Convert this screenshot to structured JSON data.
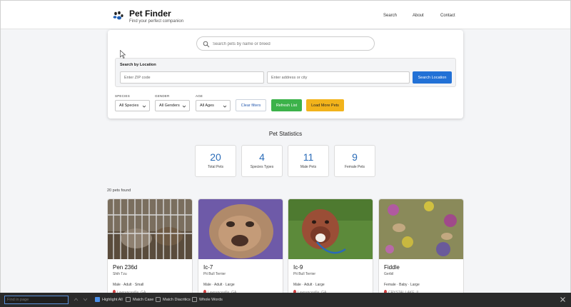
{
  "header": {
    "brand": "Pet Finder",
    "tagline": "Find your perfect companion",
    "nav": [
      "Search",
      "About",
      "Contact"
    ]
  },
  "search": {
    "placeholder": "Search pets by name or breed",
    "location_title": "Search by Location",
    "zip_placeholder": "Enter ZIP code",
    "address_placeholder": "Enter address or city",
    "search_location_label": "Search Location"
  },
  "filters": {
    "species_label": "SPECIES",
    "species_value": "All Species",
    "gender_label": "GENDER",
    "gender_value": "All Genders",
    "age_label": "AGE",
    "age_value": "All Ages",
    "clear_label": "Clear filters",
    "refresh_label": "Refresh List",
    "load_more_label": "Load More Pets"
  },
  "stats": {
    "title": "Pet Statistics",
    "items": [
      {
        "value": "20",
        "label": "Total Pets"
      },
      {
        "value": "4",
        "label": "Species Types"
      },
      {
        "value": "11",
        "label": "Male Pets"
      },
      {
        "value": "9",
        "label": "Female Pets"
      }
    ]
  },
  "results": {
    "count_text": "20 pets found",
    "pets": [
      {
        "name": "Pen 236d",
        "breed": "Shih Tzu",
        "meta": "Male · Adult · Small",
        "location": "Lawrenceville, GA"
      },
      {
        "name": "Ic-7",
        "breed": "Pit Bull Terrier",
        "meta": "Male · Adult · Large",
        "location": "Lawrenceville, GA"
      },
      {
        "name": "Ic-9",
        "breed": "Pit Bull Terrier",
        "meta": "Male · Adult · Large",
        "location": "Lawrenceville, GA"
      },
      {
        "name": "Fiddle",
        "breed": "Gerbil",
        "meta": "Female · Baby · Large",
        "location": "CRYSTAL LAKE, IL"
      }
    ]
  },
  "findbar": {
    "placeholder": "Find in page",
    "highlight_all": "Highlight All",
    "match_case": "Match Case",
    "match_diacritics": "Match Diacritics",
    "whole_words": "Whole Words"
  },
  "colors": {
    "primary": "#2271d6",
    "success": "#3cb24a",
    "warning": "#f2b31b",
    "stat_number": "#2b6cb8"
  }
}
